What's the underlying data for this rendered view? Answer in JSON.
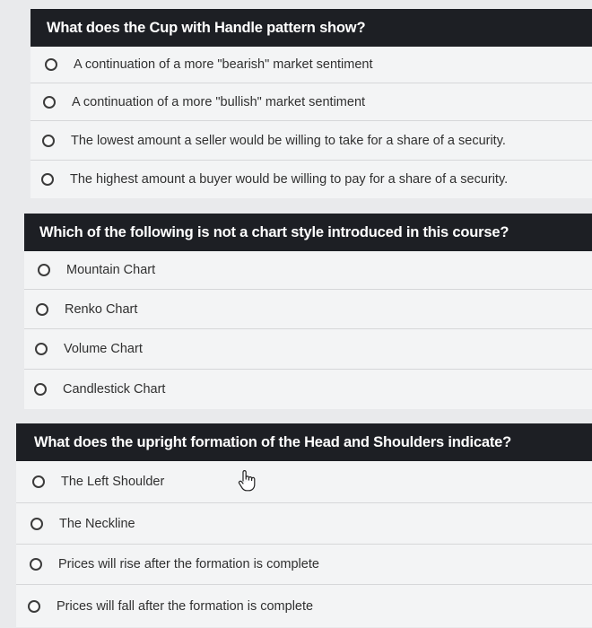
{
  "questions": [
    {
      "text": "What does the Cup with Handle pattern show?",
      "options": [
        "A continuation of a more \"bearish\" market sentiment",
        "A continuation of a more \"bullish\" market sentiment",
        "The lowest amount a seller would be willing to take for a share of a security.",
        "The highest amount a buyer would be willing to pay for a share of a security."
      ]
    },
    {
      "text": "Which of the following is not a chart style introduced in this course?",
      "options": [
        "Mountain Chart",
        "Renko Chart",
        "Volume Chart",
        "Candlestick Chart"
      ]
    },
    {
      "text": "What does the upright formation of the Head and Shoulders indicate?",
      "options": [
        "The Left Shoulder",
        "The Neckline",
        "Prices will rise after the formation is complete",
        "Prices will fall after the formation is complete"
      ]
    }
  ],
  "colors": {
    "header_bg": "#1d1f24",
    "header_text": "#ffffff",
    "option_bg": "#f3f4f5",
    "radio_border": "#3b3b3b"
  },
  "cursor_icon": "hand-pointer-icon"
}
